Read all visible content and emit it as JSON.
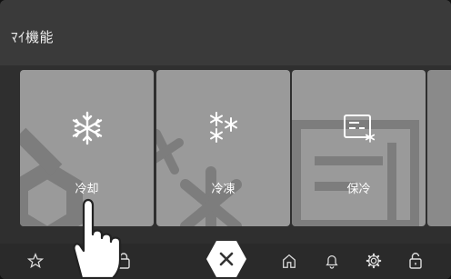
{
  "header": {
    "title": "ﾏｲ機能"
  },
  "cards": [
    {
      "label": "冷却",
      "icon": "snowflake-icon"
    },
    {
      "label": "冷凍",
      "icon": "multi-snowflake-icon"
    },
    {
      "label": "保冷",
      "icon": "cooler-box-icon"
    }
  ],
  "bottom_nav": {
    "items": [
      "star-icon",
      "lock-icon",
      "close-icon",
      "home-icon",
      "bell-icon",
      "gear-icon",
      "unlock-icon"
    ]
  },
  "colors": {
    "card": "#9a9a9a",
    "background": "#2f2f2f",
    "text": "#ffffff"
  }
}
